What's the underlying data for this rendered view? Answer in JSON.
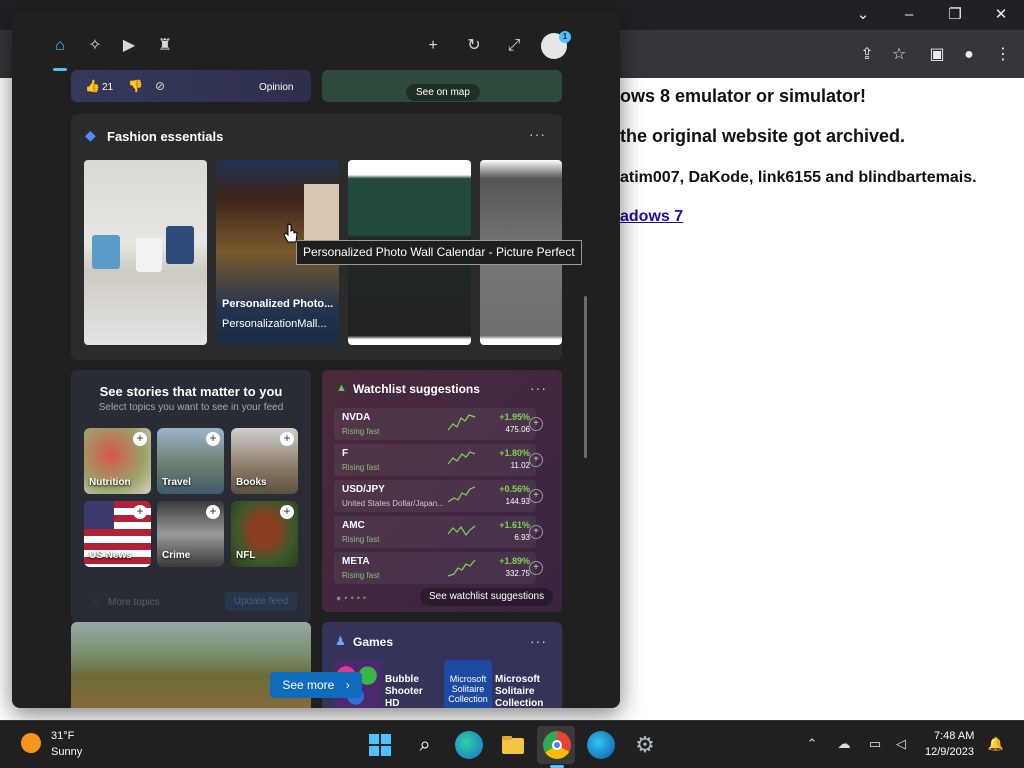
{
  "browser": {
    "page_lines": [
      "ows 8 emulator or simulator!",
      "the original website got archived.",
      "atim007, DaKode, link6155 and blindbartemais."
    ],
    "page_link": "adows 7"
  },
  "widgets": {
    "opinion": {
      "like_count": "21",
      "label": "Opinion"
    },
    "map": {
      "button": "See on map"
    },
    "fashion": {
      "title": "Fashion essentials",
      "item_title": "Personalized Photo...",
      "item_source": "PersonalizationMall..."
    },
    "tooltip": "Personalized Photo Wall Calendar - Picture Perfect",
    "stories": {
      "title": "See stories that matter to you",
      "subtitle": "Select topics you want to see in your feed",
      "topics": [
        "Nutrition",
        "Travel",
        "Books",
        "US News",
        "Crime",
        "NFL"
      ],
      "more_topics": "More topics",
      "update_feed": "Update feed"
    },
    "watchlist": {
      "title": "Watchlist suggestions",
      "stocks": [
        {
          "symbol": "NVDA",
          "sub": "Rising fast",
          "change": "+1.95%",
          "price": "475.06"
        },
        {
          "symbol": "F",
          "sub": "Rising fast",
          "change": "+1.80%",
          "price": "11.02"
        },
        {
          "symbol": "USD/JPY",
          "sub": "United States Dollar/Japan...",
          "change": "+0.56%",
          "price": "144.93"
        },
        {
          "symbol": "AMC",
          "sub": "Rising fast",
          "change": "+1.61%",
          "price": "6.93"
        },
        {
          "symbol": "META",
          "sub": "Rising fast",
          "change": "+1.89%",
          "price": "332.75"
        }
      ],
      "see_suggestions": "See watchlist suggestions"
    },
    "games": {
      "title": "Games",
      "items": [
        {
          "name": "Bubble Shooter HD"
        },
        {
          "name": "Microsoft Solitaire Collection",
          "thumb_text": "Microsoft Solitaire Collection"
        }
      ]
    },
    "see_more": "See more"
  },
  "taskbar": {
    "weather_temp": "31°F",
    "weather_desc": "Sunny",
    "time": "7:48 AM",
    "date": "12/9/2023"
  },
  "colors": {
    "accent": "#4cc2ff",
    "positive": "#7fd35a",
    "button": "#0f6cbd"
  }
}
